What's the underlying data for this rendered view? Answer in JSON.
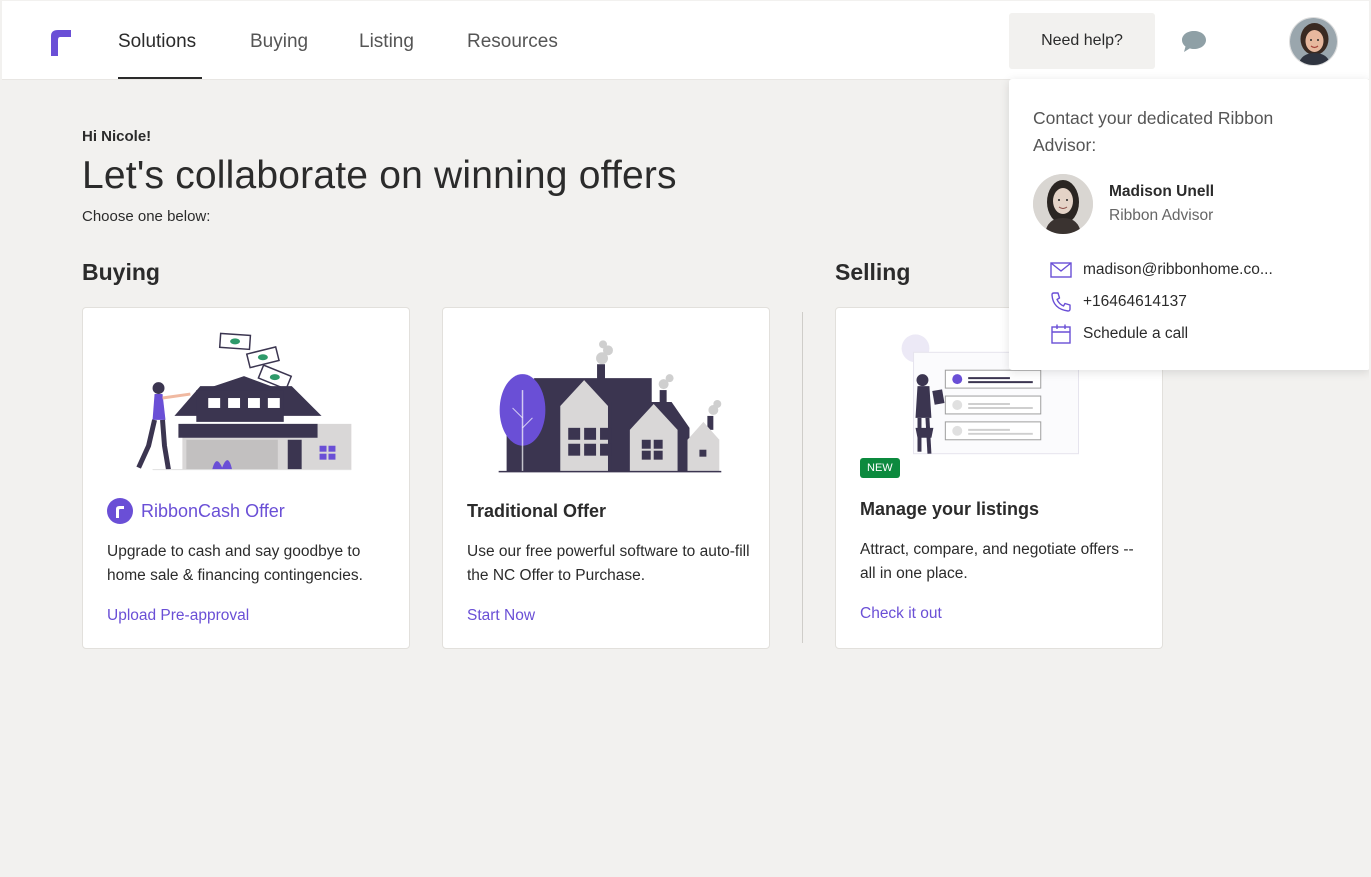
{
  "nav": {
    "items": [
      {
        "label": "Solutions",
        "active": true
      },
      {
        "label": "Buying"
      },
      {
        "label": "Listing"
      },
      {
        "label": "Resources"
      }
    ],
    "help_label": "Need help?"
  },
  "colors": {
    "accent": "#6a4fd6",
    "dark": "#3b3550",
    "new_badge": "#0c8a3e"
  },
  "main": {
    "greeting": "Hi Nicole!",
    "headline": "Let's collaborate on winning offers",
    "subhead": "Choose one below:",
    "sections": {
      "buying": "Buying",
      "selling": "Selling"
    },
    "cards": [
      {
        "title": "RibbonCash Offer",
        "description": "Upgrade to cash and say goodbye to home sale & financing contingencies.",
        "cta": "Upload Pre-approval",
        "icon": "ribbon-logo-icon"
      },
      {
        "title": "Traditional Offer",
        "description": "Use our free powerful software to auto-fill the NC Offer to Purchase.",
        "cta": "Start Now"
      },
      {
        "title": "Manage your listings",
        "description": "Attract, compare, and negotiate offers -- all in one place.",
        "cta": "Check it out",
        "badge": "NEW"
      }
    ]
  },
  "help_popover": {
    "heading": "Contact your dedicated Ribbon Advisor:",
    "advisor": {
      "name": "Madison Unell",
      "role": "Ribbon Advisor"
    },
    "contacts": [
      {
        "icon": "mail-icon",
        "text": "madison@ribbonhome.co..."
      },
      {
        "icon": "phone-icon",
        "text": "+16464614137"
      },
      {
        "icon": "calendar-icon",
        "text": "Schedule a call"
      }
    ]
  }
}
